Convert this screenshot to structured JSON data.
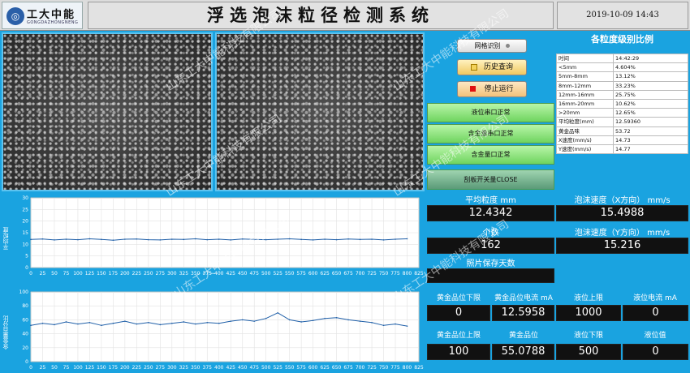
{
  "header": {
    "logo_text": "工大中能",
    "logo_sub": "GONGDAZHONGNENG",
    "title": "浮选泡沫粒径检测系统",
    "datetime": "2019-10-09  14:43"
  },
  "watermark": "山东工大中能科技有限公司",
  "controls": {
    "mode_label": "网格识别",
    "history_label": "历史查询",
    "stop_label": "停止运行",
    "status": [
      "液位串口正常",
      "含金量串口正常",
      "含金量口正常",
      "刮板开关量CLOSE"
    ]
  },
  "ratio_table": {
    "title": "各粒度级别比例",
    "rows": [
      [
        "时间",
        "14:42:29"
      ],
      [
        "<5mm",
        "4.604%"
      ],
      [
        "5mm-8mm",
        "13.12%"
      ],
      [
        "8mm-12mm",
        "33.23%"
      ],
      [
        "12mm-16mm",
        "25.75%"
      ],
      [
        "16mm-20mm",
        "10.62%"
      ],
      [
        ">20mm",
        "12.65%"
      ],
      [
        "平均粒度(mm)",
        "12.59360"
      ],
      [
        "黄金品味",
        "53.72"
      ],
      [
        "X速度(mm/s)",
        "14.73"
      ],
      [
        "Y速度(mm/s)",
        "14.77"
      ]
    ]
  },
  "readings": {
    "avg_size_label": "平均粒度  mm",
    "avg_size_value": "12.4342",
    "speed_x_label": "泡沫速度（X方向） mm/s",
    "speed_x_value": "15.4988",
    "count_label": "个数",
    "count_value": "162",
    "speed_y_label": "泡沫速度（Y方向） mm/s",
    "speed_y_value": "15.216",
    "save_days_label": "照片保存天数",
    "save_days_value": "",
    "gold_lower_label": "黄金品位下限",
    "gold_lower_value": "0",
    "gold_current_label": "黄金品位电流  mA",
    "gold_current_value": "12.5958",
    "level_upper_label": "液位上限",
    "level_upper_value": "1000",
    "level_current_label": "液位电流    mA",
    "level_current_value": "0",
    "gold_upper_label": "黄金品位上限",
    "gold_upper_value": "100",
    "gold_grade_label": "黄金品位",
    "gold_grade_value": "55.0788",
    "level_lower_label": "液位下限",
    "level_lower_value": "500",
    "level_value_label": "液位值",
    "level_value_value": "0"
  },
  "chart_data": [
    {
      "type": "line",
      "ylabel": "平均粒度",
      "xlim": [
        0,
        825
      ],
      "ylim": [
        0,
        30
      ],
      "xticks": [
        0,
        25,
        50,
        75,
        100,
        125,
        150,
        175,
        200,
        225,
        250,
        275,
        300,
        325,
        350,
        375,
        400,
        425,
        450,
        475,
        500,
        525,
        550,
        575,
        600,
        625,
        650,
        675,
        700,
        725,
        750,
        775,
        800,
        825
      ],
      "yticks": [
        0,
        5,
        10,
        15,
        20,
        25,
        30
      ],
      "grid": true,
      "color": "#1f5fa8",
      "series": [
        {
          "x": [
            0,
            25,
            50,
            75,
            100,
            125,
            150,
            175,
            200,
            225,
            250,
            275,
            300,
            325,
            350,
            375,
            400,
            425,
            450,
            475,
            500,
            525,
            550,
            575,
            600,
            625,
            650,
            675,
            700,
            725,
            750,
            775,
            800
          ],
          "values": [
            12.1,
            12.3,
            11.9,
            12.2,
            12.0,
            12.4,
            12.1,
            11.8,
            12.2,
            12.3,
            12.0,
            11.9,
            12.2,
            12.1,
            12.4,
            12.0,
            12.2,
            11.9,
            12.3,
            12.1,
            12.0,
            12.2,
            12.4,
            12.1,
            11.9,
            12.2,
            12.0,
            12.3,
            12.1,
            12.2,
            11.9,
            12.2,
            12.4
          ]
        }
      ]
    },
    {
      "type": "line",
      "ylabel": "含金量百分比",
      "xlim": [
        0,
        825
      ],
      "ylim": [
        0,
        100
      ],
      "xticks": [
        0,
        25,
        50,
        75,
        100,
        125,
        150,
        175,
        200,
        225,
        250,
        275,
        300,
        325,
        350,
        375,
        400,
        425,
        450,
        475,
        500,
        525,
        550,
        575,
        600,
        625,
        650,
        675,
        700,
        725,
        750,
        775,
        800,
        825
      ],
      "yticks": [
        0,
        20,
        40,
        60,
        80,
        100
      ],
      "grid": true,
      "color": "#1f5fa8",
      "series": [
        {
          "x": [
            0,
            25,
            50,
            75,
            100,
            125,
            150,
            175,
            200,
            225,
            250,
            275,
            300,
            325,
            350,
            375,
            400,
            425,
            450,
            475,
            500,
            525,
            550,
            575,
            600,
            625,
            650,
            675,
            700,
            725,
            750,
            775,
            800
          ],
          "values": [
            52,
            55,
            53,
            57,
            54,
            56,
            52,
            55,
            58,
            54,
            56,
            53,
            55,
            57,
            54,
            56,
            55,
            58,
            60,
            58,
            62,
            70,
            60,
            57,
            59,
            62,
            63,
            60,
            58,
            56,
            52,
            54,
            51
          ]
        }
      ]
    }
  ]
}
